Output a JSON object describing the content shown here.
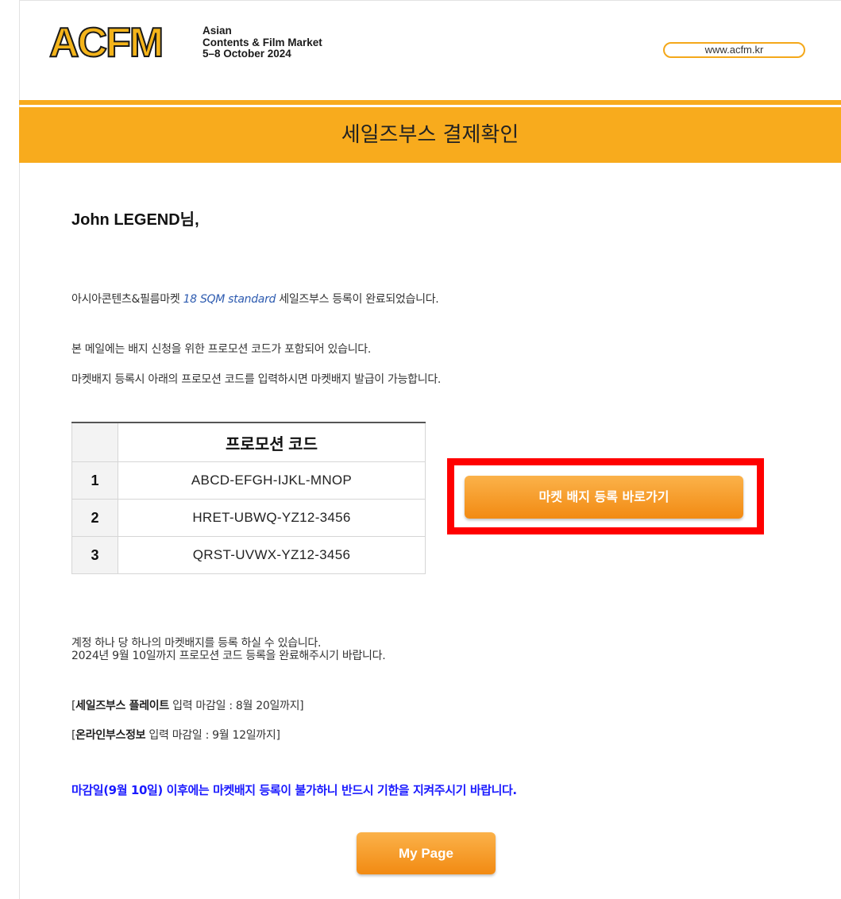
{
  "header": {
    "logo_mark": "ACFM",
    "logo_line1": "Asian",
    "logo_line2": "Contents & Film Market",
    "logo_line3": "5–8 October 2024",
    "site_link": "www.acfm.kr"
  },
  "banner": {
    "title": "세일즈부스 결제확인"
  },
  "greeting": "John LEGEND님,",
  "intro": {
    "before": "아시아콘텐츠&필름마켓 ",
    "booth_type": "18 SQM standard",
    "after": " 세일즈부스 등록이 완료되었습니다."
  },
  "promo_notice": [
    "본 메일에는 배지 신청을 위한 프로모션 코드가 포함되어 있습니다.",
    "마켓배지 등록시 아래의 프로모션 코드를 입력하시면 마켓배지 발급이 가능합니다."
  ],
  "promo_table": {
    "header": "프로모션 코드",
    "rows": [
      {
        "num": "1",
        "code": "ABCD-EFGH-IJKL-MNOP"
      },
      {
        "num": "2",
        "code": "HRET-UBWQ-YZ12-3456"
      },
      {
        "num": "3",
        "code": "QRST-UVWX-YZ12-3456"
      }
    ]
  },
  "badge_button": "마켓 배지 등록 바로가기",
  "account_notes": [
    "계정 하나 당 하나의 마켓배지를 등록 하실 수 있습니다.",
    "2024년 9월 10일까지 프로모션 코드 등록을 완료해주시기 바랍니다."
  ],
  "deadlines": [
    {
      "open": "[",
      "bold": "세일즈부스 플레이트",
      "rest": " 입력 마감일 : 8월 20일까지]"
    },
    {
      "open": "[",
      "bold": "온라인부스정보",
      "rest": " 입력 마감일 : 9월 12일까지]"
    }
  ],
  "deadline_warning": "마감일(9월 10일) 이후에는 마켓배지 등록이 불가하니 반드시 기한을 지켜주시기 바랍니다.",
  "mypage_button": "My Page",
  "colors": {
    "accent": "#f8ab1d",
    "highlight_frame": "#ff0000",
    "warning_text": "#1a1aff",
    "link_text": "#2d5bb0"
  }
}
